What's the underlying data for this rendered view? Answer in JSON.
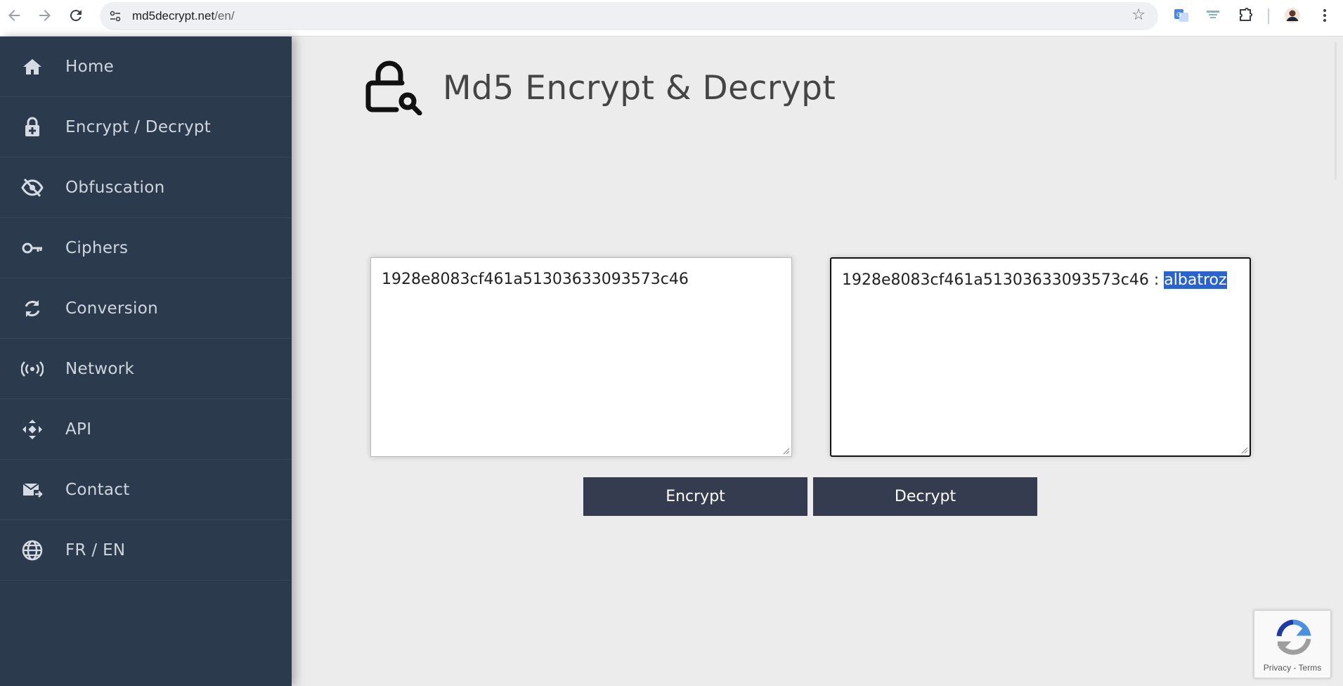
{
  "browser": {
    "url_host": "md5decrypt.net",
    "url_path": "/en/",
    "icons": [
      "back-icon",
      "forward-icon",
      "reload-icon",
      "site-settings-icon",
      "bookmark-star-icon",
      "google-translate-icon",
      "extension-icon",
      "extensions-puzzle-icon",
      "profile-avatar",
      "more-menu-icon"
    ]
  },
  "sidebar": {
    "items": [
      {
        "label": "Home",
        "icon": "home-icon"
      },
      {
        "label": "Encrypt / Decrypt",
        "icon": "lock-plus-icon"
      },
      {
        "label": "Obfuscation",
        "icon": "eye-slash-icon"
      },
      {
        "label": "Ciphers",
        "icon": "key-icon"
      },
      {
        "label": "Conversion",
        "icon": "sync-icon"
      },
      {
        "label": "Network",
        "icon": "broadcast-icon"
      },
      {
        "label": "API",
        "icon": "api-arrows-icon"
      },
      {
        "label": "Contact",
        "icon": "mail-forward-icon"
      },
      {
        "label": "FR / EN",
        "icon": "globe-icon"
      }
    ]
  },
  "main": {
    "title": "Md5 Encrypt & Decrypt",
    "input_text": "1928e8083cf461a51303633093573c46",
    "output_prefix": "1928e8083cf461a51303633093573c46 : ",
    "output_selected": "albatroz",
    "encrypt_label": "Encrypt",
    "decrypt_label": "Decrypt"
  },
  "recaptcha": {
    "text": "Privacy - Terms"
  },
  "colors": {
    "sidebar_bg": "#2b3a4d",
    "button_bg": "#353c50",
    "page_bg": "#ececec",
    "selection": "#2962d2"
  }
}
